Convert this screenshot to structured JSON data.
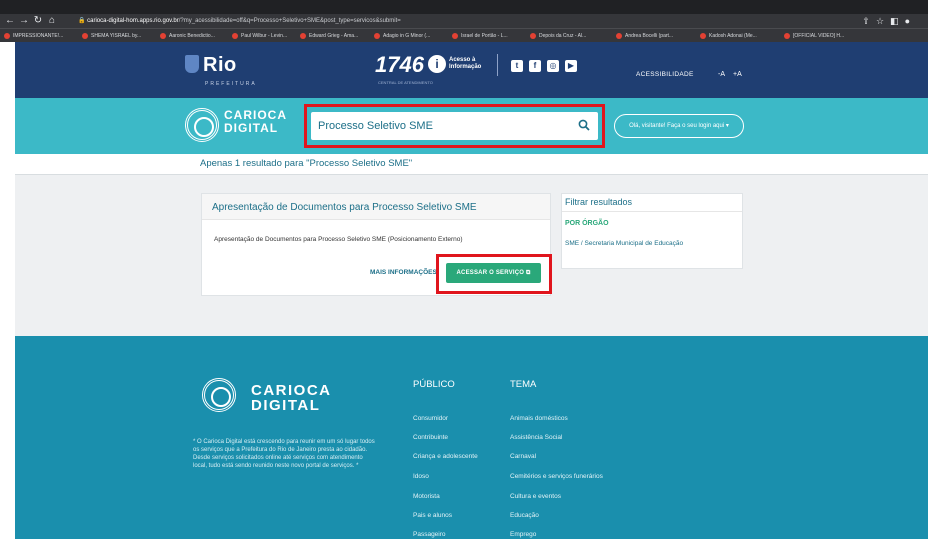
{
  "browser": {
    "url_host": "carioca-digital-hom.apps.rio.gov.br",
    "url_path": "/?my_acessibilidade=off&q=Processo+Seletivo+SME&post_type=servicos&submit=",
    "bookmarks": [
      "IMPRESSIONANTE!...",
      "SHEMA YISRAEL by...",
      "Aaronic Benedictio...",
      "Paul Wilbur - Levin...",
      "Edward Grieg - Ama...",
      "Adagio in G Minor (...",
      "Israel de Portão - L...",
      "Depois da Cruz - Al...",
      "Andrea Bocelli (part...",
      "Kadosh Adonai (Me...",
      "[OFFICIAL VIDEO] H..."
    ]
  },
  "header": {
    "brand": "Rio",
    "brand_sub": "PREFEITURA",
    "number": "1746",
    "number_sub": "CENTRAL DE ATENDIMENTO",
    "acesso_line1": "Acesso à",
    "acesso_line2": "Informação",
    "acessibilidade": "ACESSIBILIDADE",
    "font_minus": "-A",
    "font_plus": "+A"
  },
  "subheader": {
    "logo_line1": "CARIOCA",
    "logo_line2": "DIGITAL",
    "search_value": "Processo Seletivo SME",
    "login_label": "Olá, visitante! Faça o seu login aqui"
  },
  "results": {
    "summary": "Apenas 1 resultado para \"Processo Seletivo SME\"",
    "card": {
      "title": "Apresentação de Documentos para Processo Seletivo SME",
      "description": "Apresentação de Documentos para Processo Seletivo SME (Posicionamento Externo)",
      "more_info": "MAIS INFORMAÇÕES",
      "access_button": "ACESSAR O SERVIÇO"
    },
    "filter": {
      "title": "Filtrar resultados",
      "subtitle": "POR ÓRGÃO",
      "item": "SME / Secretaria Municipal de Educação"
    }
  },
  "footer": {
    "logo_line1": "CARIOCA",
    "logo_line2": "DIGITAL",
    "about": "* O Carioca Digital está crescendo para reunir em um só lugar todos os serviços que a Prefeitura do Rio de Janeiro presta ao cidadão. Desde serviços solicitados online até serviços com atendimento local, tudo está sendo reunido neste novo portal de serviços. *",
    "col1_title": "PÚBLICO",
    "col1_items": [
      "Consumidor",
      "Contribuinte",
      "Criança e adolescente",
      "Idoso",
      "Motorista",
      "Pais e alunos",
      "Passageiro"
    ],
    "col2_title": "TEMA",
    "col2_items": [
      "Animais domésticos",
      "Assistência Social",
      "Carnaval",
      "Cemitérios e serviços funerários",
      "Cultura e eventos",
      "Educação",
      "Emprego"
    ]
  },
  "colors": {
    "header_blue": "#1f3e72",
    "teal": "#3cb9c7",
    "footer_teal": "#1a8fad",
    "accent_green": "#2aa87a",
    "highlight_red": "#e0151d"
  }
}
